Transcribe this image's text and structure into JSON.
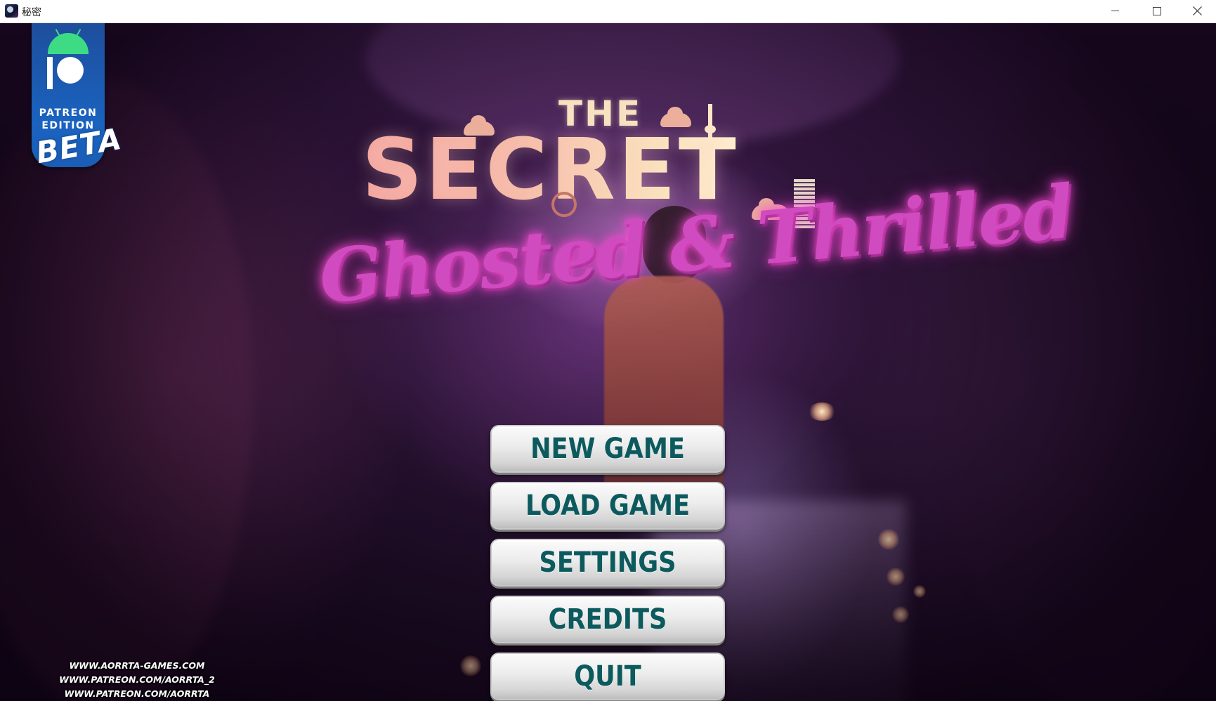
{
  "window": {
    "title": "秘密",
    "icon": "game-app-icon",
    "controls": {
      "minimize": "minimize-icon",
      "maximize": "maximize-icon",
      "close": "close-icon"
    }
  },
  "badge": {
    "line1": "PATREON",
    "line2": "EDITION",
    "tag": "BETA",
    "icon": "patreon-android-logo"
  },
  "logo": {
    "the": "THE",
    "secret": "SECRET",
    "subtitle": "Ghosted & Thrilled"
  },
  "menu": {
    "items": [
      {
        "label": "NEW GAME"
      },
      {
        "label": "LOAD GAME"
      },
      {
        "label": "SETTINGS"
      },
      {
        "label": "CREDITS"
      },
      {
        "label": "QUIT"
      }
    ]
  },
  "links": [
    "WWW.AORRTA-GAMES.COM",
    "WWW.PATREON.COM/AORRTA_2",
    "WWW.PATREON.COM/AORRTA"
  ],
  "colors": {
    "button_text": "#0c5a5e",
    "subtitle_pink": "#d04bbf",
    "badge_blue": "#1a63c0",
    "android_green": "#3ddc84"
  }
}
